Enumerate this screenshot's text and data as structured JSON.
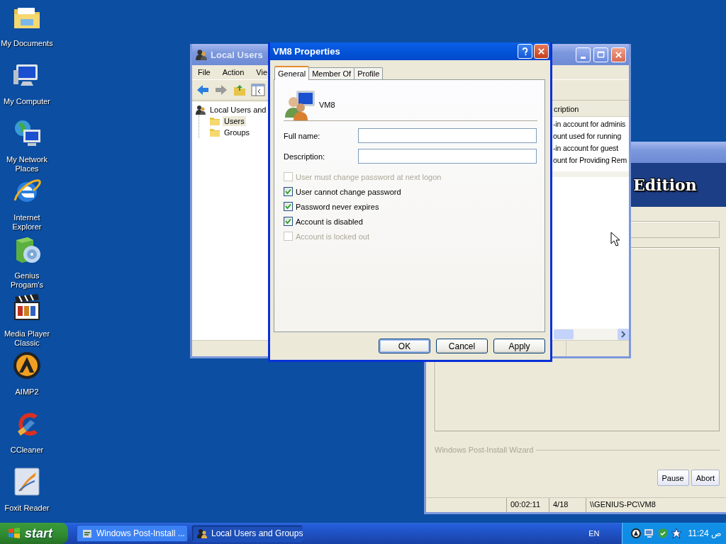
{
  "desktop_icons": [
    {
      "label": "My Documents"
    },
    {
      "label": "My Computer"
    },
    {
      "label": "My Network Places"
    },
    {
      "label": "Internet Explorer"
    },
    {
      "label": "Genius Progam's"
    },
    {
      "label": "Media Player Classic"
    },
    {
      "label": "AIMP2"
    },
    {
      "label": "CCleaner"
    },
    {
      "label": "Foxit Reader"
    }
  ],
  "wizard_window": {
    "header_text": "Edition",
    "group_label": "Windows Post-Install Wizard",
    "buttons": [
      "Pause",
      "Abort"
    ],
    "status_bar": [
      "00:02:11",
      "4/18",
      "\\\\GENIUS-PC\\VM8"
    ]
  },
  "users_window": {
    "title": "Local Users",
    "menu": [
      "File",
      "Action",
      "Vie"
    ],
    "tree": [
      {
        "label": "Local Users and",
        "selected": false,
        "children": [
          {
            "label": "Users",
            "selected": true
          },
          {
            "label": "Groups",
            "selected": false
          }
        ]
      }
    ],
    "list": {
      "column": "cription",
      "rows": [
        "-in account for adminis",
        "ount used for running",
        "-in account for guest",
        "ount for Providing Rem"
      ]
    }
  },
  "dialog": {
    "title": "VM8 Properties",
    "tabs": [
      {
        "label": "General",
        "selected": true
      },
      {
        "label": "Member Of",
        "selected": false
      },
      {
        "label": "Profile",
        "selected": false
      }
    ],
    "user_name": "VM8",
    "fields": [
      {
        "label": "Full name:"
      },
      {
        "label": "Description:"
      }
    ],
    "checkboxes": [
      {
        "label": "User must change password at next logon",
        "checked": false,
        "disabled": true
      },
      {
        "label": "User cannot change password",
        "checked": true,
        "disabled": false
      },
      {
        "label": "Password never expires",
        "checked": true,
        "disabled": false
      },
      {
        "label": "Account is disabled",
        "checked": true,
        "disabled": false
      },
      {
        "label": "Account is locked out",
        "checked": false,
        "disabled": true
      }
    ],
    "buttons": [
      {
        "label": "OK",
        "default": true
      },
      {
        "label": "Cancel",
        "default": false
      },
      {
        "label": "Apply",
        "default": false
      }
    ]
  },
  "taskbar": {
    "start": "start",
    "tasks": [
      {
        "label": "Windows Post-Install ...",
        "selected": false
      },
      {
        "label": "Local Users and Groups",
        "selected": true
      }
    ],
    "language": "EN",
    "clock": "11:24 ص"
  }
}
